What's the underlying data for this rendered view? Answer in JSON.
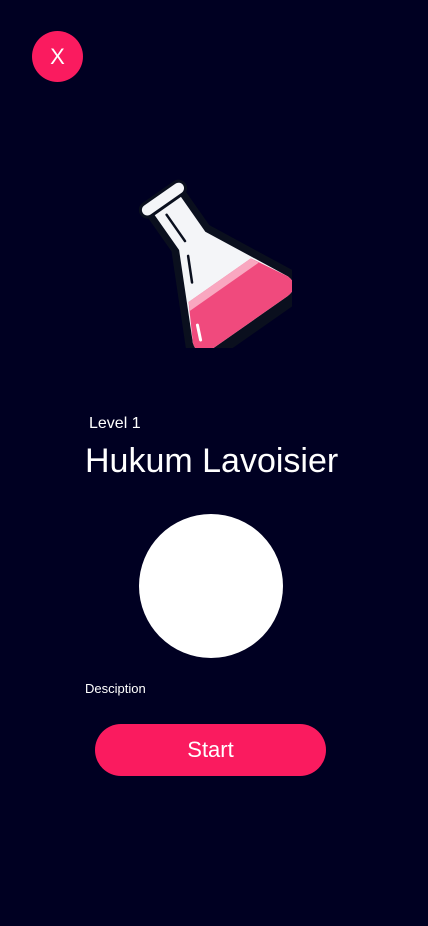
{
  "header": {
    "close_label": "X"
  },
  "illustration": {
    "icon": "flask-icon"
  },
  "level": {
    "label": "Level 1",
    "title": "Hukum Lavoisier"
  },
  "main": {
    "description_label": "Desciption",
    "start_label": "Start"
  },
  "colors": {
    "background": "#000022",
    "accent": "#fa1b5f",
    "liquid": "#f04a7d"
  }
}
